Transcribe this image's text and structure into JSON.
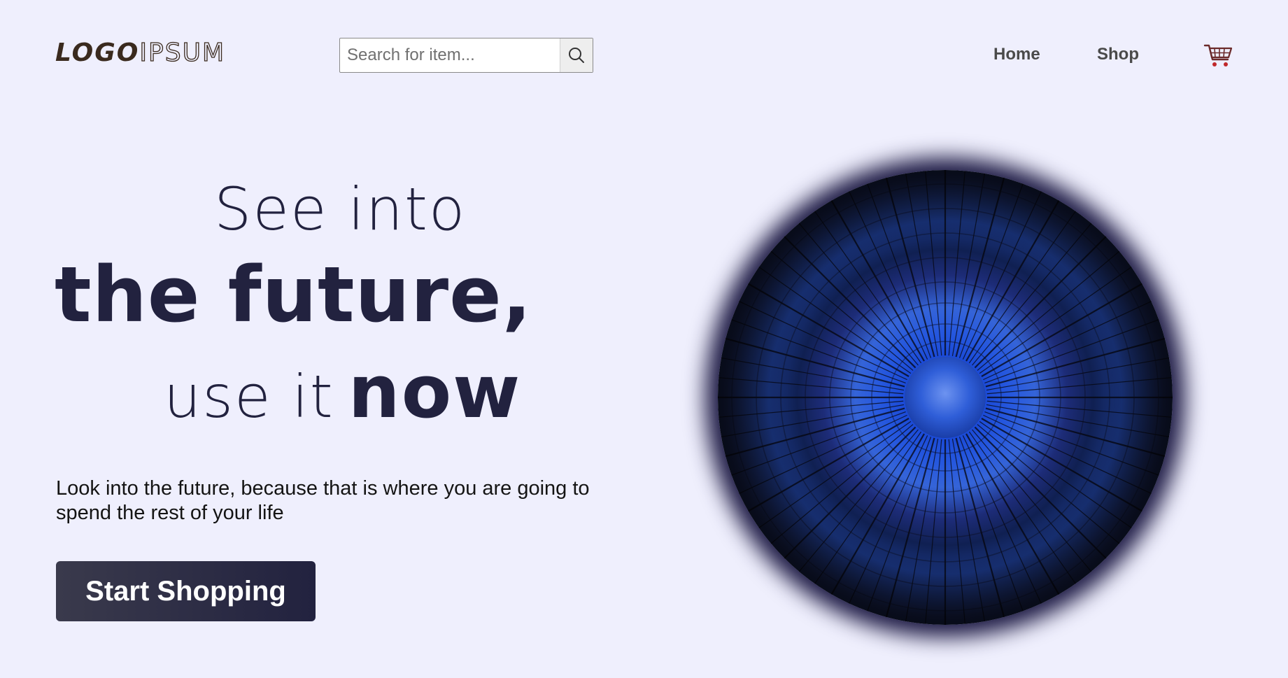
{
  "header": {
    "logo": {
      "bold": "LOGO",
      "outline": "IPSUM"
    },
    "search": {
      "placeholder": "Search for item...",
      "value": "",
      "button_icon": "search-icon"
    },
    "nav": [
      {
        "label": "Home"
      },
      {
        "label": "Shop"
      }
    ],
    "cart_icon": "shopping-cart-icon"
  },
  "hero": {
    "line1": "See into",
    "line2": "the future,",
    "line3_light": "use it",
    "line3_bold": "now",
    "tagline": "Look into the future, because that is where you are going to spend the rest of your life",
    "cta_label": "Start Shopping",
    "image_icon": "futuristic-tunnel-orb-image"
  },
  "colors": {
    "background": "#efeffd",
    "heading": "#22223f",
    "button": "#22223f",
    "logo": "#3a2a1e"
  }
}
